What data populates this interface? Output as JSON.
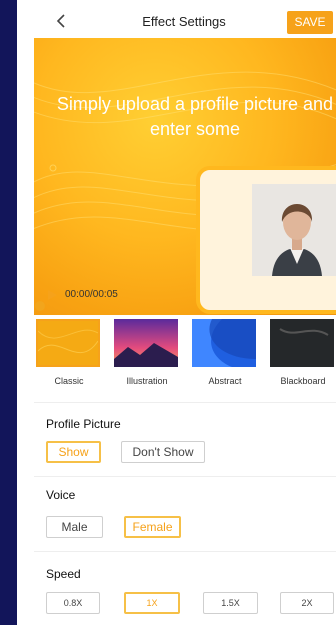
{
  "header": {
    "title": "Effect Settings",
    "save_label": "SAVE"
  },
  "preview": {
    "headline": "Simply upload a profile picture and enter some",
    "time": "00:00/00:05"
  },
  "styles": [
    {
      "label": "Classic",
      "selected": true
    },
    {
      "label": "Illustration",
      "selected": false
    },
    {
      "label": "Abstract",
      "selected": false
    },
    {
      "label": "Blackboard",
      "selected": false
    }
  ],
  "profile_picture": {
    "label": "Profile Picture",
    "options": [
      "Show",
      "Don't Show"
    ],
    "selected": "Show"
  },
  "voice": {
    "label": "Voice",
    "options": [
      "Male",
      "Female"
    ],
    "selected": "Female"
  },
  "speed": {
    "label": "Speed",
    "options": [
      "0.8X",
      "1X",
      "1.5X",
      "2X"
    ],
    "selected": "1X"
  },
  "colors": {
    "accent": "#f6a21a",
    "selected_border": "#f6c047",
    "page_background": "#12155a"
  },
  "icons": {
    "back": "chevron-left-icon",
    "play": "play-icon"
  }
}
